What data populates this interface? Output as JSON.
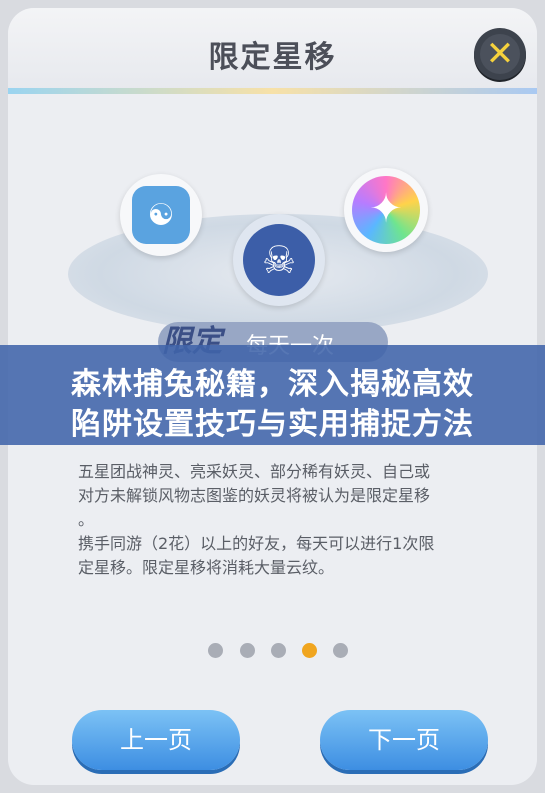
{
  "header": {
    "title": "限定星移"
  },
  "close_button": {
    "glyph": "✕"
  },
  "scene": {
    "left_icon": "yin-yang-icon",
    "center_icon": "demon-mask-icon",
    "right_icon": "sparkle-icon",
    "banner_logo": "限定",
    "banner_text": "每天一次"
  },
  "overlay": {
    "line1": "森林捕兔秘籍，深入揭秘高效",
    "line2": "陷阱设置技巧与实用捕捉方法"
  },
  "description": {
    "line1": "五星团战神灵、亮采妖灵、部分稀有妖灵、自己或",
    "line2": "对方未解锁风物志图鉴的妖灵将被认为是限定星移",
    "line3": "。",
    "line4": "携手同游（2花）以上的好友，每天可以进行1次限",
    "line5": "定星移。限定星移将消耗大量云纹。"
  },
  "pagination": {
    "total": 5,
    "active_index": 3,
    "active_color": "#f0a51f",
    "inactive_color": "#a9adb6"
  },
  "buttons": {
    "prev_label": "上一页",
    "next_label": "下一页"
  },
  "colors": {
    "accent_blue": "#3d8ee2",
    "overlay_blue": "#4064aa",
    "close_x_yellow": "#f6d23d"
  }
}
